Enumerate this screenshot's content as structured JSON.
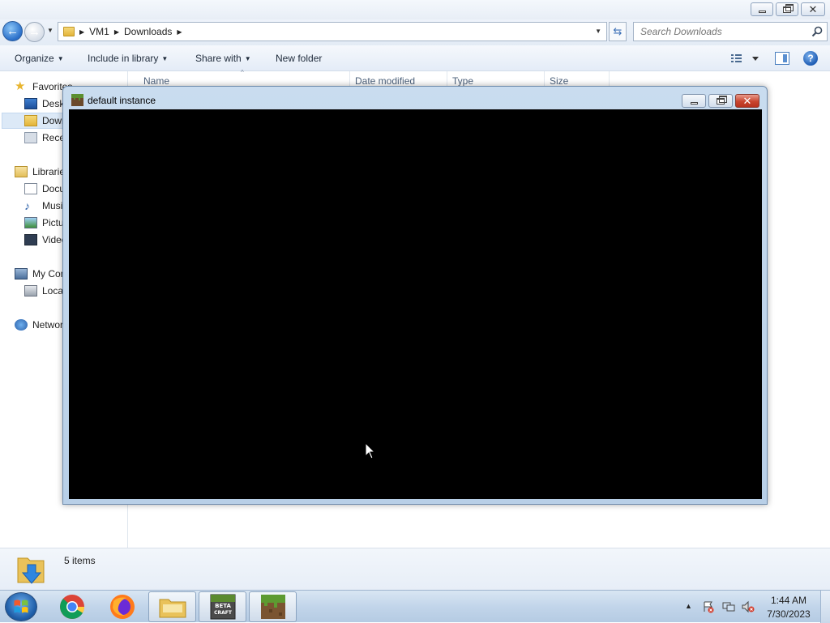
{
  "explorer": {
    "breadcrumb": [
      "VM1",
      "Downloads"
    ],
    "search": {
      "placeholder": "Search Downloads"
    },
    "toolbar": {
      "organize": "Organize",
      "include_in_library": "Include in library",
      "share_with": "Share with",
      "new_folder": "New folder"
    },
    "nav": {
      "favorites": "Favorites",
      "desktop": "Desktop",
      "downloads": "Downloads",
      "recent": "Recent Places",
      "libraries": "Libraries",
      "documents": "Documents",
      "music": "Music",
      "pictures": "Pictures",
      "videos": "Videos",
      "computer": "My Computer",
      "local_disk": "Local Disk",
      "network": "Network"
    },
    "columns": [
      "Name",
      "Date modified",
      "Type",
      "Size"
    ],
    "status": {
      "item_count": "5 items"
    }
  },
  "game_window": {
    "title": "default instance"
  },
  "taskbar": {
    "clock": {
      "time": "1:44 AM",
      "date": "7/30/2023"
    },
    "pinned": [
      "chrome-icon",
      "firefox-icon",
      "file-explorer-icon",
      "betacraft-icon",
      "minecraft-icon"
    ]
  },
  "colors": {
    "canvas_bg": "#000000",
    "window_frame": "#b8cfe7",
    "taskbar": "#c2d5ea",
    "selection": "#dce9f7"
  }
}
